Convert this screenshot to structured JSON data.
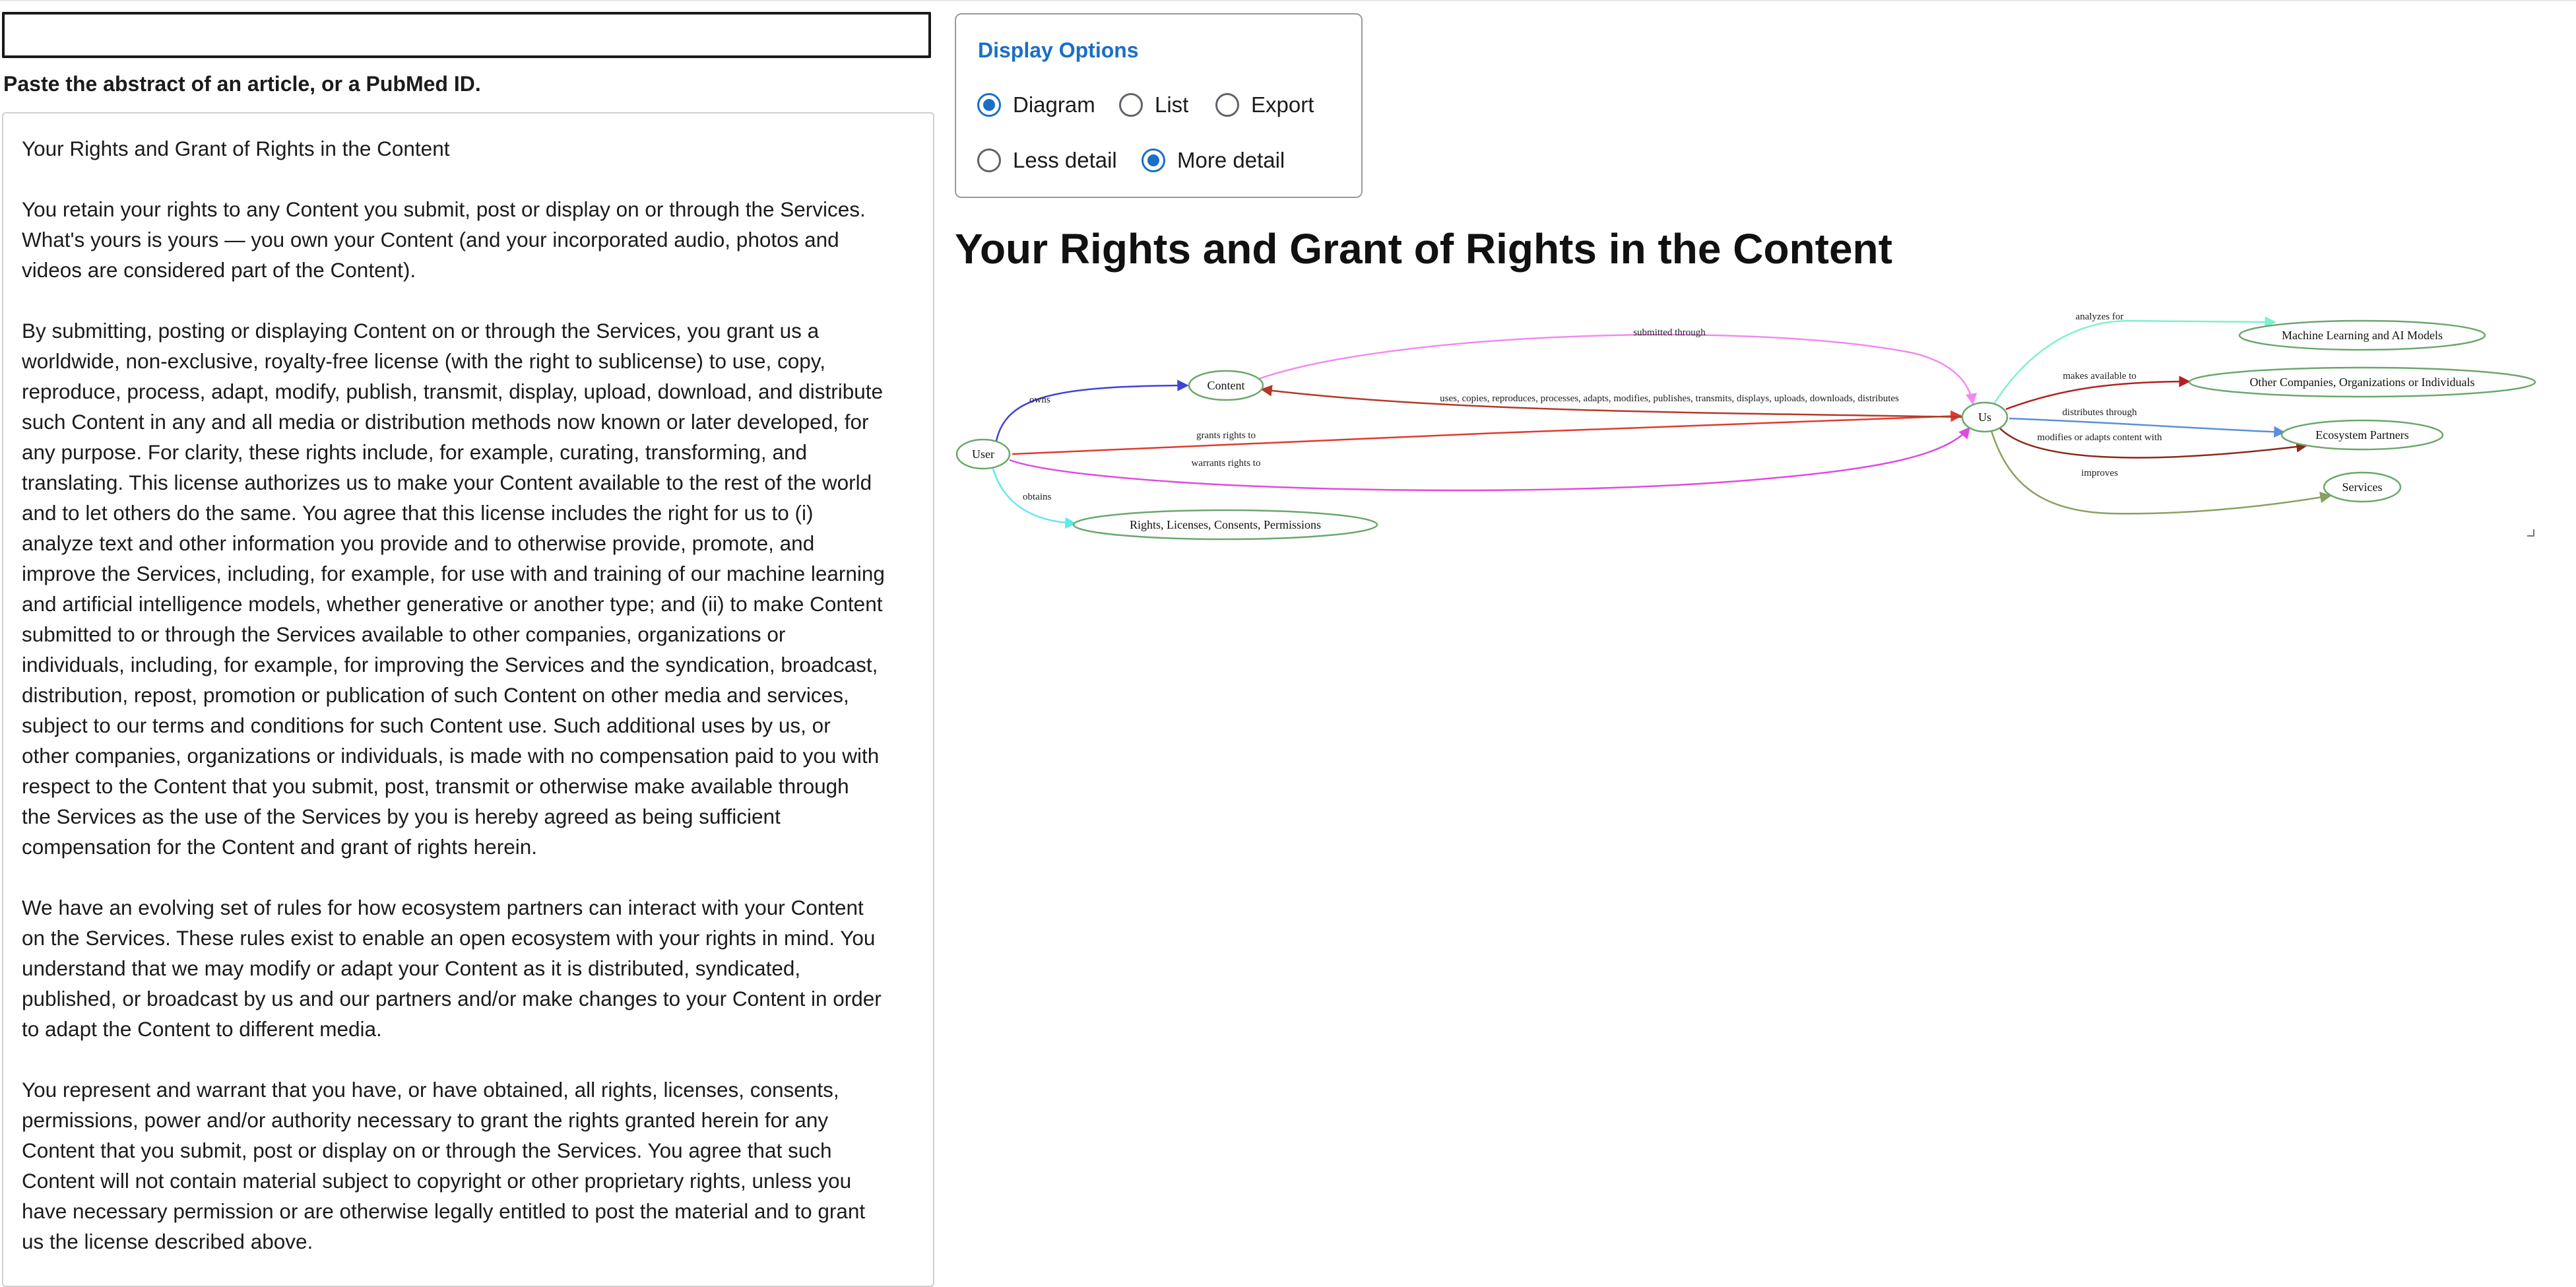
{
  "input": {
    "value": "",
    "hint": "Paste the abstract of an article, or a PubMed ID."
  },
  "abstract": {
    "title": "Your Rights and Grant of Rights in the Content",
    "paragraphs": [
      "You retain your rights to any Content you submit, post or display on or through the Services.\nWhat's yours is yours — you own your Content (and your incorporated audio, photos and\nvideos are considered part of the Content).",
      "By submitting, posting or displaying Content on or through the Services, you grant us a\nworldwide, non-exclusive, royalty-free license (with the right to sublicense) to use, copy,\nreproduce, process, adapt, modify, publish, transmit, display, upload, download, and distribute\nsuch Content in any and all media or distribution methods now known or later developed, for\nany purpose. For clarity, these rights include, for example, curating, transforming, and\ntranslating. This license authorizes us to make your Content available to the rest of the world\nand to let others do the same. You agree that this license includes the right for us to (i)\nanalyze text and other information you provide and to otherwise provide, promote, and\nimprove the Services, including, for example, for use with and training of our machine learning\nand artificial intelligence models, whether generative or another type; and (ii) to make Content\nsubmitted to or through the Services available to other companies, organizations or\nindividuals, including, for example, for improving the Services and the syndication, broadcast,\ndistribution, repost, promotion or publication of such Content on other media and services,\nsubject to our terms and conditions for such Content use. Such additional uses by us, or\nother companies, organizations or individuals, is made with no compensation paid to you with\nrespect to the Content that you submit, post, transmit or otherwise make available through\nthe Services as the use of the Services by you is hereby agreed as being sufficient\ncompensation for the Content and grant of rights herein.",
      "We have an evolving set of rules for how ecosystem partners can interact with your Content\non the Services. These rules exist to enable an open ecosystem with your rights in mind. You\nunderstand that we may modify or adapt your Content as it is distributed, syndicated,\npublished, or broadcast by us and our partners and/or make changes to your Content in order\nto adapt the Content to different media.",
      "You represent and warrant that you have, or have obtained, all rights, licenses, consents,\npermissions, power and/or authority necessary to grant the rights granted herein for any\nContent that you submit, post or display on or through the Services. You agree that such\nContent will not contain material subject to copyright or other proprietary rights, unless you\nhave necessary permission or are otherwise legally entitled to post the material and to grant\nus the license described above."
    ]
  },
  "display_options": {
    "title": "Display Options",
    "view_options": [
      {
        "label": "Diagram",
        "selected": true
      },
      {
        "label": "List",
        "selected": false
      },
      {
        "label": "Export",
        "selected": false
      }
    ],
    "detail_options": [
      {
        "label": "Less detail",
        "selected": false
      },
      {
        "label": "More detail",
        "selected": true
      }
    ]
  },
  "diagram": {
    "title": "Your Rights and Grant of Rights in the Content",
    "nodes": {
      "user": "User",
      "content": "Content",
      "rights": "Rights, Licenses, Consents, Permissions",
      "us": "Us",
      "ml": "Machine Learning and AI Models",
      "others": "Other Companies, Organizations or Individuals",
      "eco": "Ecosystem Partners",
      "services": "Services"
    },
    "edges": {
      "owns": "owns",
      "obtains": "obtains",
      "grants": "grants rights to",
      "warrants": "warrants rights to",
      "submitted": "submitted through",
      "uses": "uses, copies, reproduces, processes, adapts, modifies, publishes, transmits, displays, uploads, downloads, distributes",
      "analyzes": "analyzes for",
      "makes": "makes available to",
      "distributes": "distributes through",
      "modifies": "modifies or adapts content with",
      "improves": "improves"
    },
    "colors": {
      "node_stroke": "#6aa86a",
      "owns": "#3f43d8",
      "obtains": "#5fe8f0",
      "grants": "#e03a2e",
      "warrants": "#e04ae0",
      "submitted": "#f08af0",
      "uses": "#b33a2a",
      "analyzes": "#7ff0d0",
      "makes": "#b32020",
      "distributes": "#5b8fd8",
      "modifies": "#8a2a1a",
      "improves": "#8aa060"
    }
  }
}
